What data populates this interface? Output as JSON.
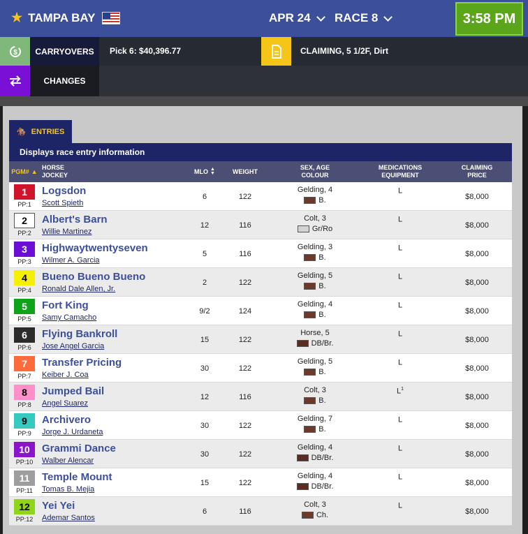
{
  "header": {
    "track": "TAMPA BAY",
    "date": "APR 24",
    "race": "RACE 8",
    "time": "3:58 PM"
  },
  "info": {
    "carryovers_label": "CARRYOVERS",
    "pick": "Pick 6: $40,396.77",
    "race_type": "CLAIMING, 5 1/2F, Dirt",
    "changes_label": "CHANGES"
  },
  "entries": {
    "tab_label": "ENTRIES",
    "description": "Displays race entry information",
    "columns": {
      "pgm": "PGM#",
      "horse": "HORSE",
      "jockey": "JOCKEY",
      "mlo": "MLO",
      "weight": "WEIGHT",
      "sex1": "SEX, AGE",
      "sex2": "COLOUR",
      "med1": "MEDICATIONS",
      "med2": "EQUIPMENT",
      "claim1": "CLAIMING",
      "claim2": "PRICE"
    },
    "rows": [
      {
        "pgm": "1",
        "pp": "PP:1",
        "horse": "Logsdon",
        "jockey": "Scott Spieth",
        "mlo": "6",
        "weight": "122",
        "sex": "Gelding, 4",
        "colour": "B.",
        "swatch": "#6b3a2a",
        "med": "L",
        "sup": "",
        "price": "$8,000",
        "bg": "#d0142c",
        "fg": "#ffffff"
      },
      {
        "pgm": "2",
        "pp": "PP:2",
        "horse": "Albert's Barn",
        "jockey": "Willie Martinez",
        "mlo": "12",
        "weight": "116",
        "sex": "Colt, 3",
        "colour": "Gr/Ro",
        "swatch": "#d4d4d4",
        "med": "L",
        "sup": "",
        "price": "$8,000",
        "bg": "#ffffff",
        "fg": "#000000"
      },
      {
        "pgm": "3",
        "pp": "PP:3",
        "horse": "Highwaytwentyseven",
        "jockey": "Wilmer A. Garcia",
        "mlo": "5",
        "weight": "116",
        "sex": "Gelding, 3",
        "colour": "B.",
        "swatch": "#6b3a2a",
        "med": "L",
        "sup": "",
        "price": "$8,000",
        "bg": "#6b0fd6",
        "fg": "#ffffff"
      },
      {
        "pgm": "4",
        "pp": "PP:4",
        "horse": "Bueno Bueno Bueno",
        "jockey": "Ronald Dale Allen, Jr.",
        "mlo": "2",
        "weight": "122",
        "sex": "Gelding, 5",
        "colour": "B.",
        "swatch": "#6b3a2a",
        "med": "L",
        "sup": "",
        "price": "$8,000",
        "bg": "#f5f000",
        "fg": "#000000"
      },
      {
        "pgm": "5",
        "pp": "PP:5",
        "horse": "Fort King",
        "jockey": "Samy Camacho",
        "mlo": "9/2",
        "weight": "124",
        "sex": "Gelding, 4",
        "colour": "B.",
        "swatch": "#6b3a2a",
        "med": "L",
        "sup": "",
        "price": "$8,000",
        "bg": "#0fa31a",
        "fg": "#ffffff"
      },
      {
        "pgm": "6",
        "pp": "PP:6",
        "horse": "Flying Bankroll",
        "jockey": "Jose Angel Garcia",
        "mlo": "15",
        "weight": "122",
        "sex": "Horse, 5",
        "colour": "DB/Br.",
        "swatch": "#5a2c22",
        "med": "L",
        "sup": "",
        "price": "$8,000",
        "bg": "#2b2b2b",
        "fg": "#ffffff"
      },
      {
        "pgm": "7",
        "pp": "PP:7",
        "horse": "Transfer Pricing",
        "jockey": "Keiber J. Coa",
        "mlo": "30",
        "weight": "122",
        "sex": "Gelding, 5",
        "colour": "B.",
        "swatch": "#6b3a2a",
        "med": "L",
        "sup": "",
        "price": "$8,000",
        "bg": "#ff6a3d",
        "fg": "#ffffff"
      },
      {
        "pgm": "8",
        "pp": "PP:8",
        "horse": "Jumped Bail",
        "jockey": "Angel Suarez",
        "mlo": "12",
        "weight": "116",
        "sex": "Colt, 3",
        "colour": "B.",
        "swatch": "#6b3a2a",
        "med": "L",
        "sup": "1",
        "price": "$8,000",
        "bg": "#ff8fc8",
        "fg": "#000000"
      },
      {
        "pgm": "9",
        "pp": "PP:9",
        "horse": "Archivero",
        "jockey": "Jorge J. Urdaneta",
        "mlo": "30",
        "weight": "122",
        "sex": "Gelding, 7",
        "colour": "B.",
        "swatch": "#6b3a2a",
        "med": "L",
        "sup": "",
        "price": "$8,000",
        "bg": "#36c9c0",
        "fg": "#000000"
      },
      {
        "pgm": "10",
        "pp": "PP:10",
        "horse": "Grammi Dance",
        "jockey": "Walber Alencar",
        "mlo": "30",
        "weight": "122",
        "sex": "Gelding, 4",
        "colour": "DB/Br.",
        "swatch": "#5a2c22",
        "med": "L",
        "sup": "",
        "price": "$8,000",
        "bg": "#8b13c9",
        "fg": "#ffffff"
      },
      {
        "pgm": "11",
        "pp": "PP:11",
        "horse": "Temple Mount",
        "jockey": "Tomas B. Mejia",
        "mlo": "15",
        "weight": "122",
        "sex": "Gelding, 4",
        "colour": "DB/Br.",
        "swatch": "#5a2c22",
        "med": "L",
        "sup": "",
        "price": "$8,000",
        "bg": "#9e9e9e",
        "fg": "#ffffff"
      },
      {
        "pgm": "12",
        "pp": "PP:12",
        "horse": "Yei Yei",
        "jockey": "Ademar Santos",
        "mlo": "6",
        "weight": "116",
        "sex": "Colt, 3",
        "colour": "Ch.",
        "swatch": "#6e3b2a",
        "med": "L",
        "sup": "",
        "price": "$8,000",
        "bg": "#8fd61a",
        "fg": "#000000"
      }
    ]
  },
  "icons": {
    "star": "star-icon",
    "flag": "us-flag-icon",
    "carryover": "dollar-cycle-icon",
    "document": "document-icon",
    "changes": "swap-arrows-icon",
    "horse": "horse-icon"
  },
  "colors": {
    "header": "#3c4f9a",
    "clock": "#5aa519",
    "carryover_icon": "#7fb87a",
    "document_icon": "#f5c518",
    "changes_icon": "#7a0fd6",
    "navy": "#1d2566"
  }
}
